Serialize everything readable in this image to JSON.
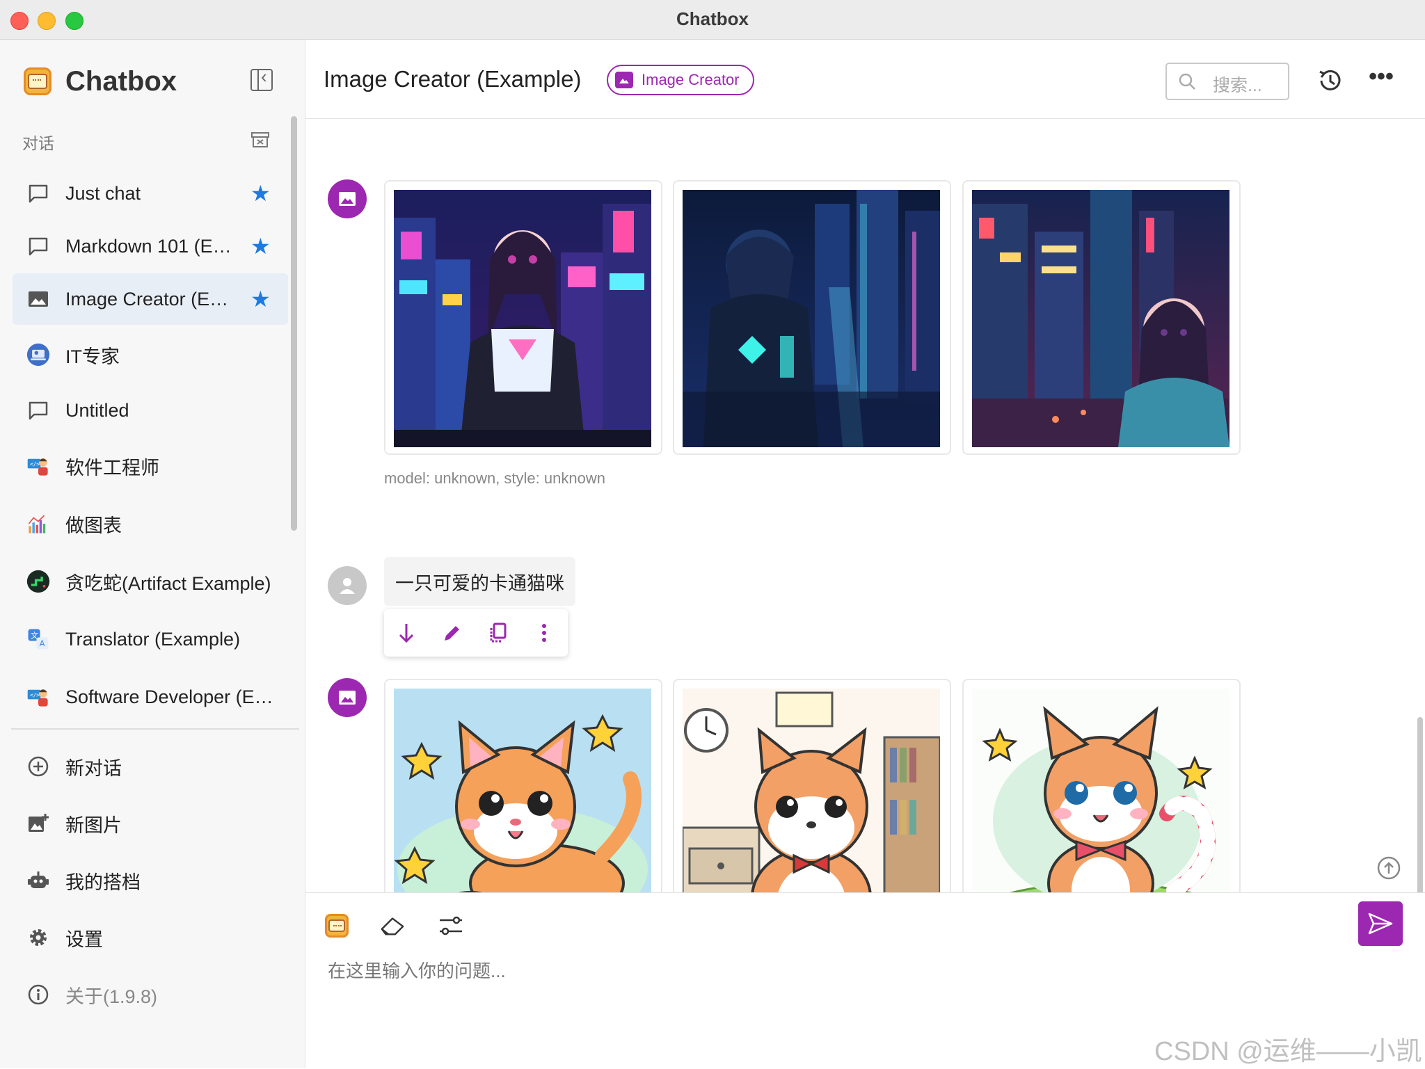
{
  "window": {
    "title": "Chatbox"
  },
  "sidebar": {
    "brand": "Chatbox",
    "section_label": "对话",
    "conversations": [
      {
        "label": "Just chat",
        "icon": "chat-bubble-icon",
        "starred": true
      },
      {
        "label": "Markdown 101 (E…",
        "icon": "chat-bubble-icon",
        "starred": true
      },
      {
        "label": "Image Creator (E…",
        "icon": "image-icon",
        "starred": true,
        "active": true
      },
      {
        "label": "IT专家",
        "icon": "it-avatar-icon",
        "starred": false
      },
      {
        "label": "Untitled",
        "icon": "chat-bubble-icon",
        "starred": false
      },
      {
        "label": "软件工程师",
        "icon": "engineer-avatar-icon",
        "starred": false
      },
      {
        "label": "做图表",
        "icon": "chart-avatar-icon",
        "starred": false
      },
      {
        "label": "贪吃蛇(Artifact Example)",
        "icon": "snake-avatar-icon",
        "starred": false
      },
      {
        "label": "Translator (Example)",
        "icon": "translate-avatar-icon",
        "starred": false
      },
      {
        "label": "Software Developer (E…",
        "icon": "developer-avatar-icon",
        "starred": false
      }
    ],
    "menu": [
      {
        "label": "新对话",
        "icon": "plus-circle-icon"
      },
      {
        "label": "新图片",
        "icon": "add-image-icon"
      },
      {
        "label": "我的搭档",
        "icon": "robot-icon"
      },
      {
        "label": "设置",
        "icon": "gear-icon"
      },
      {
        "label": "关于(1.9.8)",
        "icon": "info-icon"
      }
    ]
  },
  "header": {
    "title": "Image Creator (Example)",
    "tag": "Image Creator",
    "search_placeholder": "搜索..."
  },
  "messages": {
    "first_meta": "model: unknown, style: unknown",
    "user_text": "一只可爱的卡通猫咪"
  },
  "input": {
    "placeholder": "在这里输入你的问题..."
  },
  "watermark": "CSDN @运维——小凯",
  "colors": {
    "accent": "#9c27b0",
    "star": "#1e7ae0",
    "active_bg": "#e8eef6"
  }
}
